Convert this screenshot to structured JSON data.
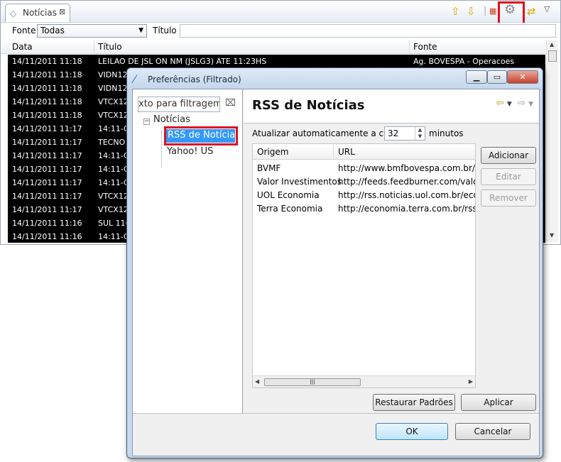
{
  "view": {
    "tab_label": "Notícias",
    "fonte_label": "Fonte",
    "fonte_value": "Todas",
    "titulo_label": "Título",
    "titulo_value": "",
    "columns": [
      "Data",
      "Título",
      "Fonte"
    ],
    "rows": [
      {
        "data": "14/11/2011 11:18",
        "titulo": "LEILAO DE JSL  ON NM (JSLG3) ATE 11:23HS",
        "fonte": "Ag. BOVESPA - Operacoes"
      },
      {
        "data": "14/11/2011 11:18",
        "titulo": "VIDN12",
        "fonte": ""
      },
      {
        "data": "14/11/2011 11:18",
        "titulo": "VIDN12",
        "fonte": ""
      },
      {
        "data": "14/11/2011 11:18",
        "titulo": "VTCX12",
        "fonte": ""
      },
      {
        "data": "14/11/2011 11:18",
        "titulo": "VTCX12",
        "fonte": ""
      },
      {
        "data": "14/11/2011 11:17",
        "titulo": "14:11-O",
        "fonte": ""
      },
      {
        "data": "14/11/2011 11:17",
        "titulo": "TECNO",
        "fonte": ""
      },
      {
        "data": "14/11/2011 11:17",
        "titulo": "14:11-O",
        "fonte": ""
      },
      {
        "data": "14/11/2011 11:17",
        "titulo": "14:11-O",
        "fonte": ""
      },
      {
        "data": "14/11/2011 11:17",
        "titulo": "14:11-O",
        "fonte": ""
      },
      {
        "data": "14/11/2011 11:17",
        "titulo": "VTCX12",
        "fonte": ""
      },
      {
        "data": "14/11/2011 11:17",
        "titulo": "VTCX12",
        "fonte": ""
      },
      {
        "data": "14/11/2011 11:16",
        "titulo": "SUL 116",
        "fonte": ""
      },
      {
        "data": "14/11/2011 11:16",
        "titulo": "14:11-O",
        "fonte": ""
      }
    ]
  },
  "dialog": {
    "title": "Preferências (Filtrado)",
    "filter_text": "xto para filtragem",
    "tree_root": "Notícias",
    "tree_selected": "RSS de Notícias",
    "tree_other": "Yahoo! US",
    "page_title": "RSS de Notícias",
    "update_label": "Atualizar automaticamente a cada",
    "update_value": "32",
    "minutes_label": "minutos",
    "table_columns": [
      "Origem",
      "URL"
    ],
    "feeds": [
      {
        "origem": "BVMF",
        "url": "http://www.bmfbovespa.com.br/Not"
      },
      {
        "origem": "Valor Investimentos",
        "url": "http://feeds.feedburner.com/valoron"
      },
      {
        "origem": "UOL Economia",
        "url": "http://rss.noticias.uol.com.br/econor"
      },
      {
        "origem": "Terra Economia",
        "url": "http://economia.terra.com.br/rss/po"
      }
    ],
    "btn_add": "Adicionar",
    "btn_edit": "Editar",
    "btn_remove": "Remover",
    "btn_restore": "Restaurar Padrões",
    "btn_apply": "Aplicar",
    "btn_ok": "OK",
    "btn_cancel": "Cancelar"
  },
  "accent_colors": {
    "highlight": "#e0101f",
    "selection": "#3399ff"
  }
}
